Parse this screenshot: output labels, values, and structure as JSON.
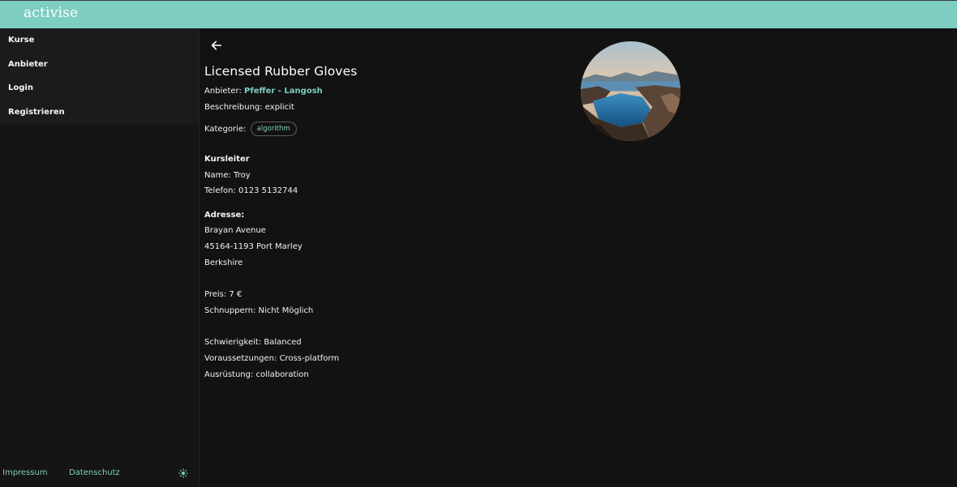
{
  "app": {
    "logo_text": "activise"
  },
  "sidebar": {
    "items": [
      {
        "label": "Kurse"
      },
      {
        "label": "Anbieter"
      },
      {
        "label": "Login"
      },
      {
        "label": "Registrieren"
      }
    ],
    "footer": {
      "impressum": "Impressum",
      "datenschutz": "Datenschutz",
      "theme_icon": "sun-icon"
    }
  },
  "course": {
    "title": "Licensed Rubber Gloves",
    "provider_label": "Anbieter:",
    "provider_name": "Pfeffer - Langosh",
    "description": "Beschreibung: explicit",
    "category_label": "Kategorie:",
    "category_chip": "algorithm",
    "instructor_heading": "Kursleiter",
    "instructor_name": "Name: Troy",
    "instructor_phone": "Telefon: 0123 5132744",
    "address_heading": "Adresse:",
    "address_street": "Brayan Avenue",
    "address_city": "45164-1193 Port Marley",
    "address_region": "Berkshire",
    "price": "Preis: 7 €",
    "trial": "Schnuppern: Nicht Möglich",
    "difficulty": "Schwierigkeit: Balanced",
    "requirements": "Voraussetzungen: Cross-platform",
    "equipment": "Ausrüstung: collaboration"
  },
  "colors": {
    "accent": "#7ecdc2",
    "background": "#121212",
    "sidebar": "#1a1c1c"
  }
}
